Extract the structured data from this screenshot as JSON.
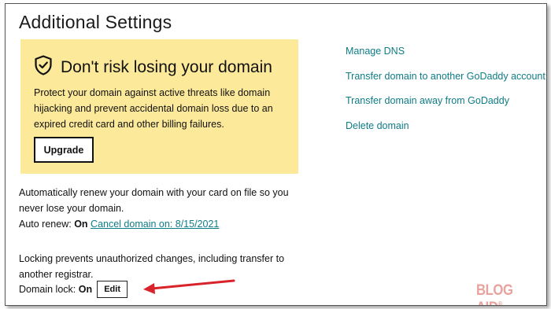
{
  "page": {
    "title": "Additional Settings"
  },
  "promo": {
    "title": "Don't risk losing your domain",
    "body": "Protect your domain against active threats like domain hijacking and prevent accidental domain loss due to an expired credit card and other billing failures.",
    "upgrade_label": "Upgrade",
    "icon": "shield-check-icon",
    "background": "#fce99a"
  },
  "auto_renew": {
    "description": "Automatically renew your domain with your card on file so you never lose your domain.",
    "label": "Auto renew:",
    "status": "On",
    "cancel_link": "Cancel domain on: 8/15/2021"
  },
  "domain_lock": {
    "description": "Locking prevents unauthorized changes, including transfer to another registrar.",
    "label": "Domain lock:",
    "status": "On",
    "edit_label": "Edit"
  },
  "side_links": [
    "Manage DNS",
    "Transfer domain to another GoDaddy account",
    "Transfer domain away from GoDaddy",
    "Delete domain"
  ],
  "watermark": {
    "text": "BLOG AID",
    "symbol": "®"
  },
  "colors": {
    "link": "#0e7c86",
    "arrow": "#d9232a",
    "watermark": "#e8a39f"
  }
}
